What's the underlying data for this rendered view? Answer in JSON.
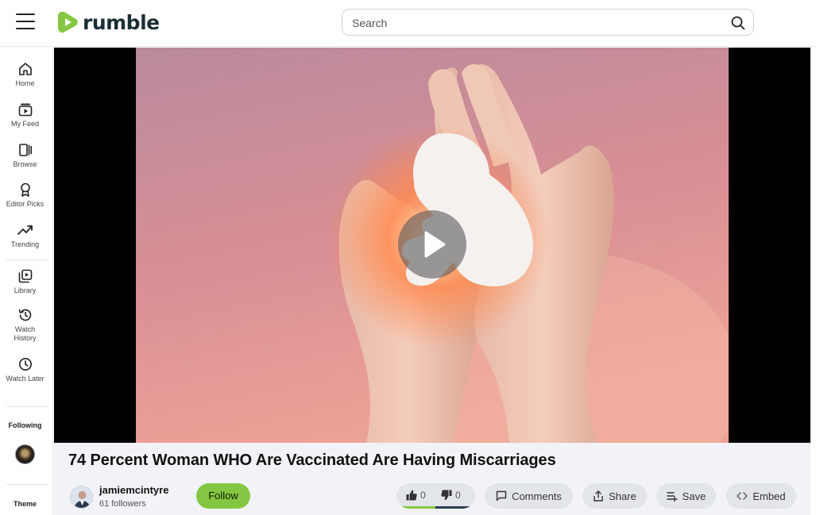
{
  "header": {
    "logo_text": "rumble",
    "search_placeholder": "Search"
  },
  "sidebar": {
    "items": [
      {
        "label": "Home",
        "icon": "home-icon"
      },
      {
        "label": "My Feed",
        "icon": "feed-icon"
      },
      {
        "label": "Browse",
        "icon": "browse-icon"
      },
      {
        "label": "Editor Picks",
        "icon": "award-icon"
      },
      {
        "label": "Trending",
        "icon": "trending-icon"
      },
      {
        "label": "Library",
        "icon": "library-icon"
      },
      {
        "label": "Watch History",
        "icon": "history-icon"
      },
      {
        "label": "Watch Later",
        "icon": "clock-icon"
      }
    ],
    "following_label": "Following",
    "theme_label": "Theme"
  },
  "video": {
    "title": "74 Percent Woman WHO Are Vaccinated Are Having Miscarriages"
  },
  "channel": {
    "name": "jamiemcintyre",
    "followers": "61 followers",
    "follow_label": "Follow"
  },
  "actions": {
    "likes": "0",
    "dislikes": "0",
    "comments_label": "Comments",
    "share_label": "Share",
    "save_label": "Save",
    "embed_label": "Embed"
  },
  "colors": {
    "brand_green": "#85c742",
    "logo_text": "#1a2e35",
    "info_background": "#f1f3f6",
    "pill_background": "#e2e6eb"
  }
}
